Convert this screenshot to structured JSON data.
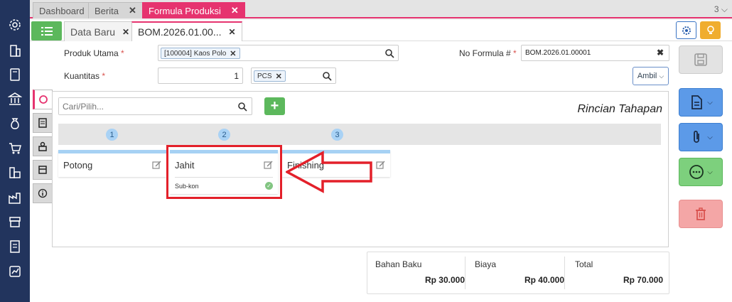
{
  "top_tabs": [
    {
      "label": "Dashboard",
      "closable": false
    },
    {
      "label": "Berita",
      "closable": true
    },
    {
      "label": "Formula Produksi",
      "closable": true,
      "active": true
    }
  ],
  "top_count": "3",
  "sub_tabs": [
    {
      "label": "Data Baru"
    },
    {
      "label": "BOM.2026.01.00...",
      "active": true
    }
  ],
  "form": {
    "produk_label": "Produk Utama",
    "produk_value": "[100004] Kaos Polo",
    "kuantitas_label": "Kuantitas",
    "kuantitas_value": "1",
    "unit_value": "PCS",
    "no_formula_label": "No Formula #",
    "no_formula_value": "BOM.2026.01.00001",
    "required_mark": "*",
    "ambil_label": "Ambil"
  },
  "panel": {
    "search_placeholder": "Cari/Pilih...",
    "title": "Rincian Tahapan",
    "steps": [
      {
        "number": "1",
        "name": "Potong",
        "sub": ""
      },
      {
        "number": "2",
        "name": "Jahit",
        "sub": "Sub-kon"
      },
      {
        "number": "3",
        "name": "Finishing",
        "sub": ""
      }
    ]
  },
  "totals": {
    "bahan_baku_label": "Bahan Baku",
    "bahan_baku_value": "Rp 30.000",
    "biaya_label": "Biaya",
    "biaya_value": "Rp 40.000",
    "total_label": "Total",
    "total_value": "Rp 70.000"
  },
  "colors": {
    "accent": "#e6336f",
    "sidebar": "#22345d",
    "green": "#5cb85c",
    "highlight_box": "#e3202a"
  }
}
